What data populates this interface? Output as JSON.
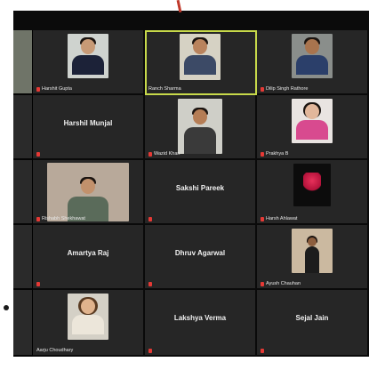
{
  "participants": {
    "harshit_gupta": "Harshit Gupta",
    "ranch_sharma": "Ranch Sharma",
    "dilip_singh_rathore": "Dilip Singh Rathore",
    "harshil_munjal": "Harshil Munjal",
    "wazid_khan": "Wazid Khan",
    "prakhya": "Prakhya B",
    "rishabh_shekhawat": "Rishabh Shekhawat",
    "sakshi_pareek": "Sakshi Pareek",
    "harsh_ahlawat": "Harsh Ahlawat",
    "amartya_raj": "Amartya Raj",
    "dhruv_agarwal": "Dhruv Agarwal",
    "ayush_chauhan": "Ayush Chauhan",
    "aarju_choudhary": "Aarju Choudhary",
    "lakshya_verma": "Lakshya Verma",
    "sejal_jain": "Sejal Jain"
  },
  "colors": {
    "active_speaker_border": "#c7d94a",
    "muted_mic": "#e53935",
    "tile_bg": "#262626"
  }
}
